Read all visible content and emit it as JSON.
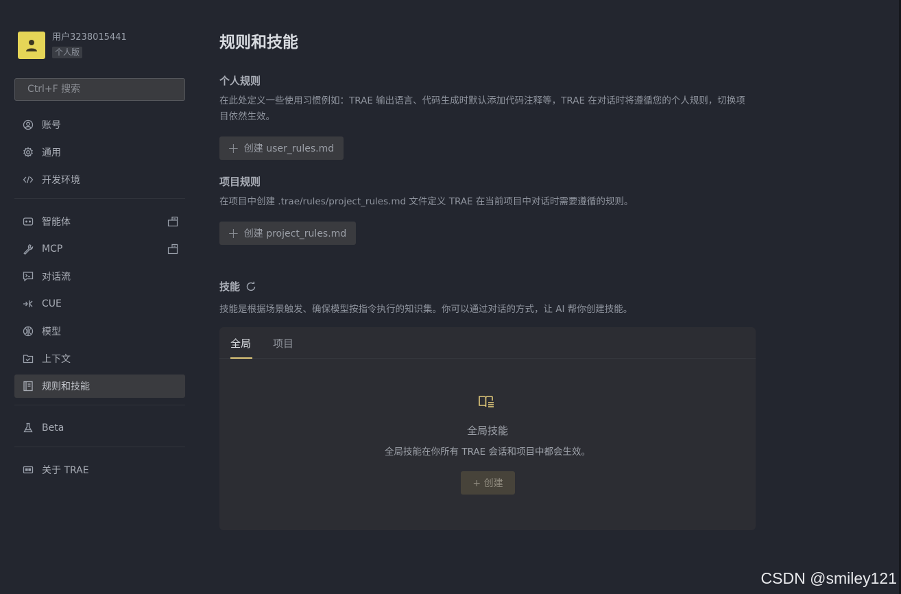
{
  "user": {
    "name": "用户3238015441",
    "plan": "个人版"
  },
  "search": {
    "placeholder": "Ctrl+F 搜索"
  },
  "sidebar": {
    "group1": [
      {
        "label": "账号",
        "icon": "user-circle-icon"
      },
      {
        "label": "通用",
        "icon": "gear-icon"
      },
      {
        "label": "开发环境",
        "icon": "code-icon"
      }
    ],
    "group2": [
      {
        "label": "智能体",
        "icon": "bot-icon",
        "external": true
      },
      {
        "label": "MCP",
        "icon": "wrench-icon",
        "external": true
      },
      {
        "label": "对话流",
        "icon": "chat-terminal-icon"
      },
      {
        "label": "CUE",
        "icon": "cue-icon"
      },
      {
        "label": "模型",
        "icon": "model-icon"
      },
      {
        "label": "上下文",
        "icon": "context-icon"
      },
      {
        "label": "规则和技能",
        "icon": "rules-book-icon",
        "active": true
      }
    ],
    "group3": [
      {
        "label": "Beta",
        "icon": "flask-icon"
      }
    ],
    "group4": [
      {
        "label": "关于 TRAE",
        "icon": "about-icon"
      }
    ]
  },
  "main": {
    "title": "规则和技能",
    "personal": {
      "title": "个人规则",
      "desc": "在此处定义一些使用习惯例如：TRAE 输出语言、代码生成时默认添加代码注释等，TRAE 在对话时将遵循您的个人规则，切换项目依然生效。",
      "button": "创建 user_rules.md"
    },
    "project": {
      "title": "项目规则",
      "desc": "在项目中创建 .trae/rules/project_rules.md 文件定义 TRAE 在当前项目中对话时需要遵循的规则。",
      "button": "创建 project_rules.md"
    },
    "skills": {
      "title": "技能",
      "desc": "技能是根据场景触发、确保模型按指令执行的知识集。你可以通过对话的方式，让 AI 帮你创建技能。",
      "tabs": [
        "全局",
        "项目"
      ],
      "empty_title": "全局技能",
      "empty_desc": "全局技能在你所有 TRAE 会话和项目中都会生效。",
      "create_label": "+ 创建"
    }
  },
  "watermark": "CSDN @smiley121",
  "colors": {
    "accent": "#e0c87a",
    "avatar": "#e5d557",
    "background": "#23262f"
  }
}
